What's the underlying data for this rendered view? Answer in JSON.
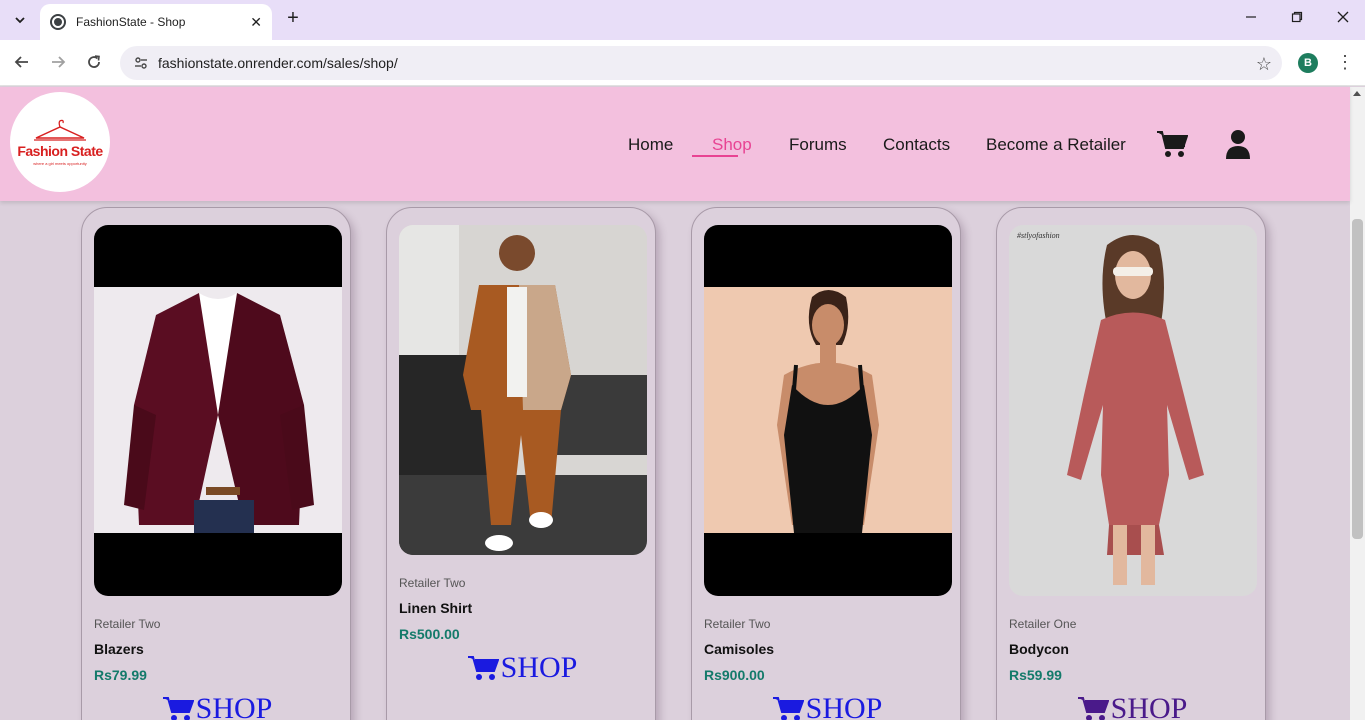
{
  "browser": {
    "tab_title": "FashionState - Shop",
    "url": "fashionstate.onrender.com/sales/shop/",
    "profile_initial": "B"
  },
  "site": {
    "logo_text": "Fashion State",
    "logo_tagline": "where a girl meets opportunity",
    "nav": {
      "home": "Home",
      "shop": "Shop",
      "forums": "Forums",
      "contacts": "Contacts",
      "become_retailer": "Become a Retailer"
    },
    "active_nav": "shop",
    "accent_color": "#e84393",
    "header_color": "#f3c0de"
  },
  "products": [
    {
      "retailer": "Retailer Two",
      "name": "Blazers",
      "price": "Rs79.99",
      "button": "SHOP",
      "image": "burgundy-velvet-blazer"
    },
    {
      "retailer": "Retailer Two",
      "name": "Linen Shirt",
      "price": "Rs500.00",
      "button": "SHOP",
      "image": "brown-checked-shirt-set"
    },
    {
      "retailer": "Retailer Two",
      "name": "Camisoles",
      "price": "Rs900.00",
      "button": "SHOP",
      "image": "black-camisole"
    },
    {
      "retailer": "Retailer One",
      "name": "Bodycon",
      "price": "Rs59.99",
      "button": "SHOP",
      "image": "rose-ribbed-dress",
      "watermark": "#stlyofashion"
    }
  ]
}
